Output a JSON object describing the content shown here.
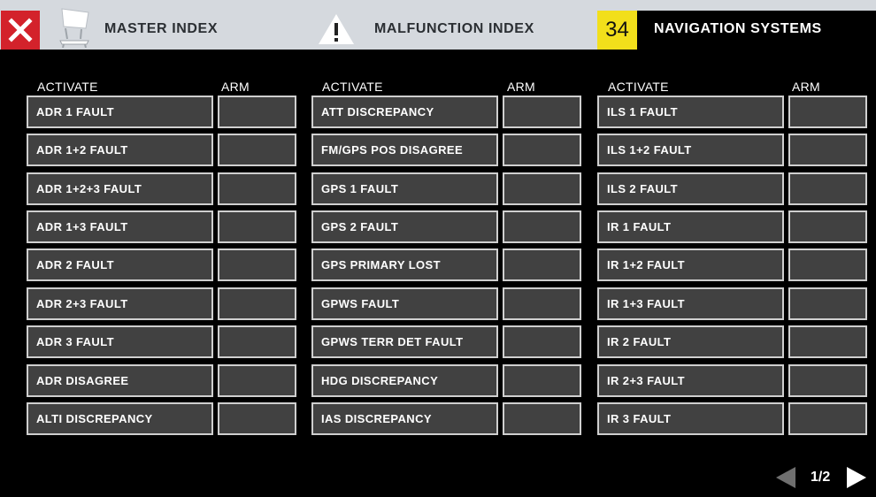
{
  "header": {
    "master_label": "MASTER INDEX",
    "malfunction_label": "MALFUNCTION INDEX",
    "chapter_number": "34",
    "chapter_title": "NAVIGATION SYSTEMS",
    "close_icon": "close-icon",
    "master_icon": "aircraft-on-stand-icon",
    "warning_icon": "warning-triangle-icon",
    "colors": {
      "close_bg": "#d3222b",
      "chapter_badge": "#f2df1b",
      "topbar_bg": "#d5d9de"
    }
  },
  "columns": [
    {
      "activate_header": "ACTIVATE",
      "arm_header": "ARM",
      "items": [
        "ADR 1 FAULT",
        "ADR 1+2 FAULT",
        "ADR 1+2+3 FAULT",
        "ADR 1+3 FAULT",
        "ADR 2 FAULT",
        "ADR 2+3 FAULT",
        "ADR 3 FAULT",
        "ADR DISAGREE",
        "ALTI DISCREPANCY"
      ]
    },
    {
      "activate_header": "ACTIVATE",
      "arm_header": "ARM",
      "items": [
        "ATT DISCREPANCY",
        "FM/GPS POS DISAGREE",
        "GPS 1 FAULT",
        "GPS 2 FAULT",
        "GPS PRIMARY LOST",
        "GPWS FAULT",
        "GPWS TERR DET FAULT",
        "HDG DISCREPANCY",
        "IAS DISCREPANCY"
      ]
    },
    {
      "activate_header": "ACTIVATE",
      "arm_header": "ARM",
      "items": [
        "ILS 1 FAULT",
        "ILS 1+2 FAULT",
        "ILS 2 FAULT",
        "IR 1 FAULT",
        "IR 1+2 FAULT",
        "IR 1+3 FAULT",
        "IR 2 FAULT",
        "IR 2+3 FAULT",
        "IR 3 FAULT"
      ]
    }
  ],
  "pager": {
    "label": "1/2",
    "prev_icon": "triangle-left-icon",
    "next_icon": "triangle-right-icon"
  }
}
